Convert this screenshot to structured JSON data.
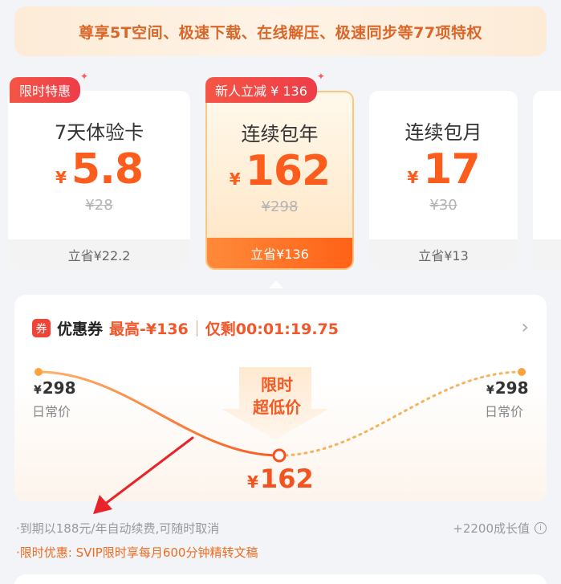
{
  "banner": {
    "text": "尊享5T空间、极速下载、在线解压、极速同步等77项特权"
  },
  "plans": [
    {
      "name": "7天体验卡",
      "currency": "¥",
      "price": "5.8",
      "original": "¥28",
      "save": "立省¥22.2",
      "tag": "限时特惠",
      "selected": false
    },
    {
      "name": "连续包年",
      "currency": "¥",
      "price": "162",
      "original": "¥298",
      "save": "立省¥136",
      "tag": "新人立减 ¥ 136",
      "selected": true
    },
    {
      "name": "连续包月",
      "currency": "¥",
      "price": "17",
      "original": "¥30",
      "save": "立省¥13",
      "tag": "",
      "selected": false
    }
  ],
  "coupon": {
    "icon_text": "券",
    "title": "优惠券",
    "max": "最高-¥136",
    "remaining": "仅剩00:01:19.75",
    "chevron_icon": "chevron-right-icon"
  },
  "price_curve": {
    "left_price": "298",
    "left_label": "日常价",
    "right_price": "298",
    "right_label": "日常价",
    "yen": "¥",
    "badge_line1": "限时",
    "badge_line2": "超低价",
    "low_price": "162"
  },
  "notes": {
    "renew": "·到期以188元/年自动续费,可随时取消",
    "promo": "·限时优惠: SVIP限时享每月600分钟精转文稿",
    "growth": "+2200成长值",
    "info_icon": "i"
  },
  "colors": {
    "accent": "#fd5d1c",
    "tag_red": "#f04436",
    "banner_text": "#d9672a"
  },
  "annotation_arrow": {
    "color": "#e8242a"
  }
}
